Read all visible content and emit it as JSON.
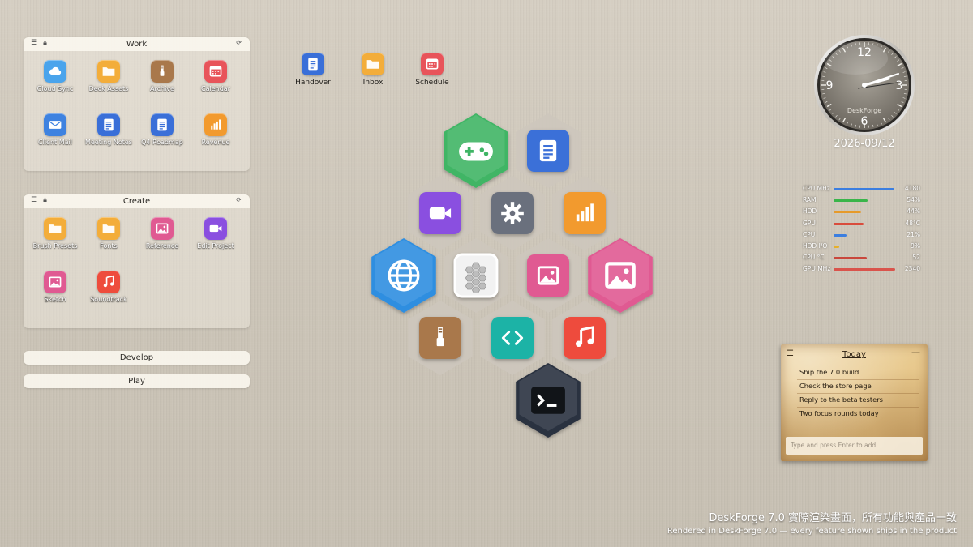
{
  "fences": {
    "work": {
      "title": "Work",
      "items": [
        {
          "label": "Cloud Sync",
          "icon": "cloud-icon",
          "color": "#4aa4ec"
        },
        {
          "label": "Deck Assets",
          "icon": "folder-icon",
          "color": "#f3ad3a"
        },
        {
          "label": "Archive",
          "icon": "archive-icon",
          "color": "#a9784b"
        },
        {
          "label": "Calendar",
          "icon": "calendar-icon",
          "color": "#e8545a"
        },
        {
          "label": "Client Mail",
          "icon": "mail-icon",
          "color": "#3e82e0"
        },
        {
          "label": "Meeting Notes",
          "icon": "document-icon",
          "color": "#3a6fd8"
        },
        {
          "label": "Q4 Roadmap",
          "icon": "document-icon",
          "color": "#3a6fd8"
        },
        {
          "label": "Revenue",
          "icon": "chart-icon",
          "color": "#f29a2e"
        }
      ]
    },
    "create": {
      "title": "Create",
      "items": [
        {
          "label": "Brush Presets",
          "icon": "folder-icon",
          "color": "#f3ad3a"
        },
        {
          "label": "Fonts",
          "icon": "folder-icon",
          "color": "#f3ad3a"
        },
        {
          "label": "Reference",
          "icon": "image-icon",
          "color": "#e05a92"
        },
        {
          "label": "Edit Project",
          "icon": "video-icon",
          "color": "#8a4fe0"
        },
        {
          "label": "Sketch",
          "icon": "image-icon",
          "color": "#e05a92"
        },
        {
          "label": "Soundtrack",
          "icon": "music-icon",
          "color": "#ee4c3c"
        }
      ]
    },
    "develop": {
      "title": "Develop"
    },
    "play": {
      "title": "Play"
    }
  },
  "desktop_icons": [
    {
      "label": "Handover",
      "icon": "document-icon",
      "color": "#3a6fd8"
    },
    {
      "label": "Inbox",
      "icon": "folder-icon",
      "color": "#f3ad3a"
    },
    {
      "label": "Schedule",
      "icon": "calendar-icon",
      "color": "#e8545a"
    }
  ],
  "hex_launcher": {
    "cells": [
      {
        "name": "games",
        "icon": "gamepad-icon",
        "color": "#3fb565"
      },
      {
        "name": "documents",
        "icon": "document-icon",
        "color": "#3a6fd8"
      },
      {
        "name": "video",
        "icon": "video-icon",
        "color": "#8a4fe0"
      },
      {
        "name": "settings",
        "icon": "gear-icon",
        "color": "#6b6f7d"
      },
      {
        "name": "charts",
        "icon": "chart-icon",
        "color": "#f29a2e"
      },
      {
        "name": "browser",
        "icon": "globe-icon",
        "color": "#2f8ee0"
      },
      {
        "name": "hub",
        "icon": "hex-cluster-icon",
        "color": "#f4f4f4"
      },
      {
        "name": "pictures",
        "icon": "image-icon",
        "color": "#e05a92"
      },
      {
        "name": "gallery",
        "icon": "image-icon",
        "color": "#e05a92"
      },
      {
        "name": "archive",
        "icon": "archive-icon",
        "color": "#a9784b"
      },
      {
        "name": "code",
        "icon": "code-icon",
        "color": "#1fb3a6"
      },
      {
        "name": "music",
        "icon": "music-icon",
        "color": "#ee4c3c"
      },
      {
        "name": "terminal",
        "icon": "terminal-icon",
        "color": "#2b3240"
      }
    ]
  },
  "clock": {
    "numerals": [
      "12",
      "3",
      "6",
      "9"
    ],
    "brand": "DeskForge",
    "date": "2026-09/12"
  },
  "system_monitor": [
    {
      "label": "CPU MHz",
      "value": "4180",
      "level": 0.96,
      "color": "#3b7ee0"
    },
    {
      "label": "RAM",
      "value": "54%",
      "level": 0.54,
      "color": "#3ab54a"
    },
    {
      "label": "HDD",
      "value": "44%",
      "level": 0.44,
      "color": "#e69a2a"
    },
    {
      "label": "GPU",
      "value": "48°C",
      "level": 0.48,
      "color": "#d94c3c"
    },
    {
      "label": "CPU",
      "value": "21%",
      "level": 0.21,
      "color": "#3b7ee0"
    },
    {
      "label": "HDD I/O",
      "value": "9%",
      "level": 0.09,
      "color": "#e6b02a"
    },
    {
      "label": "CPU °C",
      "value": "52",
      "level": 0.52,
      "color": "#c9473c"
    },
    {
      "label": "GPU MHz",
      "value": "2340",
      "level": 0.98,
      "color": "#d9544c"
    }
  ],
  "note": {
    "title": "Today",
    "items": [
      "Ship the 7.0 build",
      "Check the store page",
      "Reply to the beta testers",
      "Two focus rounds today"
    ],
    "input_placeholder": "Type and press Enter to add..."
  },
  "footer": {
    "line1": "DeskForge 7.0 實際渲染畫面，所有功能與產品一致",
    "line2": "Rendered in DeskForge 7.0 — every feature shown ships in the product"
  }
}
